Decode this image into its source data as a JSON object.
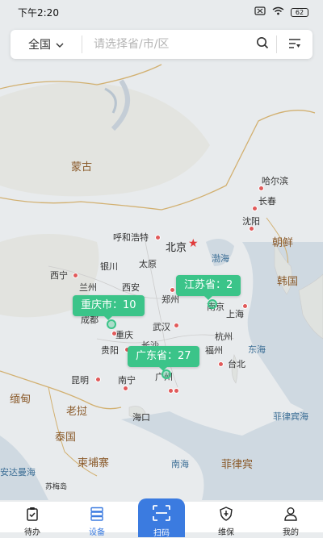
{
  "status_bar": {
    "time": "下午2:20",
    "battery": "62"
  },
  "search": {
    "region_label": "全国",
    "placeholder": "请选择省/市/区"
  },
  "map": {
    "labels": {
      "mongolia": "蒙古",
      "harbin": "哈尔滨",
      "changchun": "长春",
      "shenyang": "沈阳",
      "north_korea": "朝鲜",
      "south_korea": "韩国",
      "hohhot": "呼和浩特",
      "beijing": "北京",
      "bohai": "渤海",
      "yinchuan": "银川",
      "taiyuan": "太原",
      "xining": "西宁",
      "lanzhou": "兰州",
      "xian": "西安",
      "zhengzhou": "郑州",
      "nanjing": "南京",
      "shanghai": "上海",
      "chengdu": "成都",
      "chongqing": "重庆",
      "wuhan": "武汉",
      "hangzhou": "杭州",
      "guiyang": "贵阳",
      "changsha": "长沙",
      "fuzhou": "福州",
      "east_china_sea": "东海",
      "kunming": "昆明",
      "nanning": "南宁",
      "guangzhou": "广州",
      "taipei": "台北",
      "myanmar": "缅甸",
      "laos": "老挝",
      "haikou": "海口",
      "philippine_sea": "菲律宾海",
      "thailand": "泰国",
      "cambodia": "柬埔寨",
      "south_china_sea": "南海",
      "philippines": "菲律宾",
      "andaman_sea": "安达曼海",
      "sumei": "苏梅岛"
    },
    "bubbles": {
      "jiangsu": "江苏省：2",
      "chongqing": "重庆市：10",
      "guangdong": "广东省：27"
    }
  },
  "tabs": [
    {
      "label": "待办",
      "icon": "clipboard-icon"
    },
    {
      "label": "设备",
      "icon": "server-icon"
    },
    {
      "label": "扫码",
      "icon": "scan-icon"
    },
    {
      "label": "维保",
      "icon": "wrench-shield-icon"
    },
    {
      "label": "我的",
      "icon": "user-icon"
    }
  ]
}
